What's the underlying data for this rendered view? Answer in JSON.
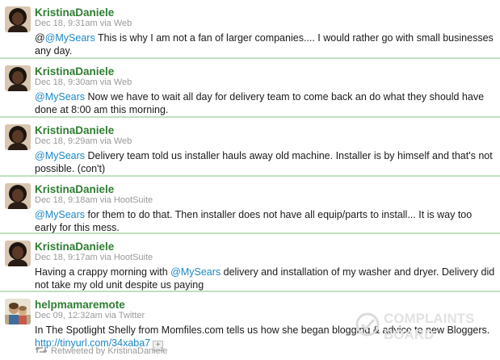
{
  "tweets": [
    {
      "user": "KristinaDaniele",
      "time": "Dec 18, 9:31am",
      "via_label": "via",
      "source": "Web",
      "pre": "@",
      "mention": "@MySears",
      "text": " This is why I am not a fan of larger companies.... I would rather go with small businesses any day.",
      "avatar": "avatar-kristina"
    },
    {
      "user": "KristinaDaniele",
      "time": "Dec 18, 9:30am",
      "via_label": "via",
      "source": "Web",
      "pre": "",
      "mention": "@MySears",
      "text": " Now we have to wait all day for delivery team to come back an do what they should have done at 8:00 am this morning.",
      "avatar": "avatar-kristina"
    },
    {
      "user": "KristinaDaniele",
      "time": "Dec 18, 9:29am",
      "via_label": "via",
      "source": "Web",
      "pre": "",
      "mention": "@MySears",
      "text": " Delivery team told us installer hauls away old machine. Installer is by himself and that's not possible. (con't)",
      "avatar": "avatar-kristina"
    },
    {
      "user": "KristinaDaniele",
      "time": "Dec 18, 9:18am",
      "via_label": "via",
      "source": "HootSuite",
      "pre": "",
      "mention": "@MySears",
      "text": " for them to do that. Then installer does not have all equip/parts to install... It is way too early for this mess.",
      "avatar": "avatar-kristina"
    },
    {
      "user": "KristinaDaniele",
      "time": "Dec 18, 9:17am",
      "via_label": "via",
      "source": "HootSuite",
      "pre_text": "Having a crappy morning with ",
      "mention": "@MySears",
      "text": " delivery and installation of my washer and dryer. Delivery did not take my old unit despite us paying",
      "avatar": "avatar-kristina"
    },
    {
      "user": "helpmamaremote",
      "time": "Dec 09, 12:32am",
      "via_label": "via",
      "source": "Twitter",
      "text": "In The Spotlight Shelly from Momfiles.com tells us how she began blogging & advice to new Bloggers.",
      "link": "http://tinyurl.com/34xaba7",
      "expand_label": "+",
      "retweet_label": "Retweeted by",
      "retweet_user": "KristinaDaniele",
      "avatar": "avatar-helpmama"
    }
  ],
  "watermark": {
    "line1": "COMPLAINTS",
    "line2": "BOARD"
  },
  "colors": {
    "username": "#2e7d32",
    "mention": "#1a88c9",
    "meta": "#999999",
    "divider": "#bfe0bf"
  }
}
